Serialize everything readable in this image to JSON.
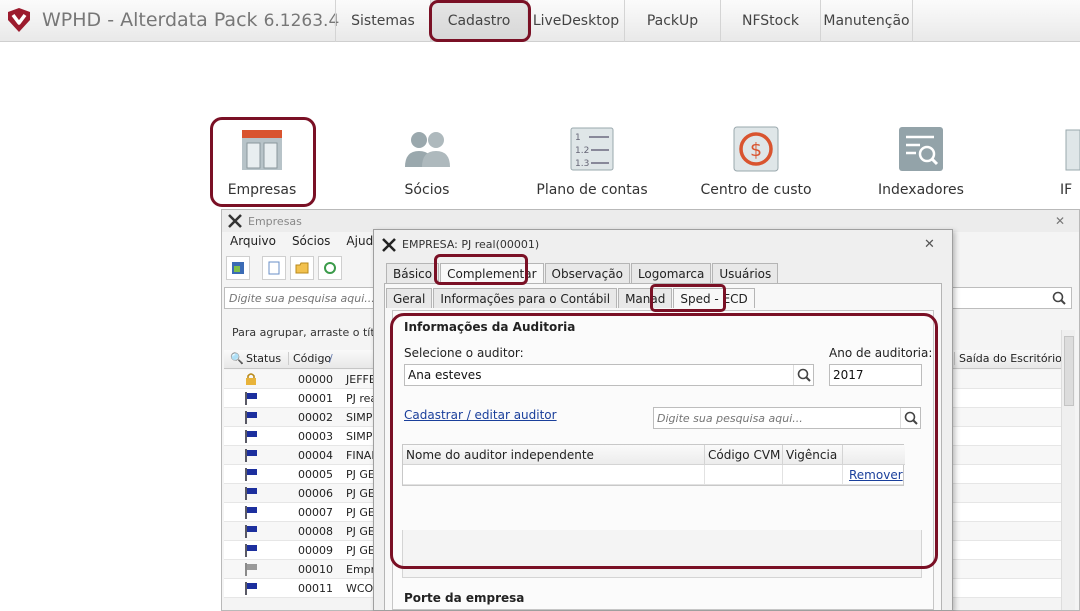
{
  "app": {
    "brand": "WPHD - Alterdata Pack",
    "version": "6.1263.4",
    "menu": [
      "Sistemas",
      "Cadastro",
      "LiveDesktop",
      "PackUp",
      "NFStock",
      "Manutenção"
    ],
    "active_menu": "Cadastro",
    "accent_color": "#7a1025"
  },
  "ribbon": [
    {
      "label": "Empresas",
      "icon": "store-icon"
    },
    {
      "label": "Sócios",
      "icon": "partners-icon"
    },
    {
      "label": "Plano de contas",
      "icon": "numbered-list-icon"
    },
    {
      "label": "Centro de custo",
      "icon": "dollar-icon"
    },
    {
      "label": "Indexadores",
      "icon": "document-search-icon"
    },
    {
      "label": "IF",
      "icon": "partial-icon"
    }
  ],
  "empresas_window": {
    "title": "Empresas",
    "menu": [
      "Arquivo",
      "Sócios",
      "Ajuda"
    ],
    "search_placeholder": "Digite sua pesquisa aqui...",
    "group_hint": "Para agrupar, arraste o título d",
    "columns": [
      "Status",
      "Código",
      "Saída do Escritório"
    ],
    "rows": [
      {
        "status": "lock",
        "codigo": "00000",
        "nome": "JEFFE"
      },
      {
        "status": "flag",
        "codigo": "00001",
        "nome": "PJ rea"
      },
      {
        "status": "flag",
        "codigo": "00002",
        "nome": "SIMP"
      },
      {
        "status": "flag",
        "codigo": "00003",
        "nome": "SIMP"
      },
      {
        "status": "flag",
        "codigo": "00004",
        "nome": "FINAN"
      },
      {
        "status": "flag",
        "codigo": "00005",
        "nome": "PJ GE"
      },
      {
        "status": "flag",
        "codigo": "00006",
        "nome": "PJ GE"
      },
      {
        "status": "flag",
        "codigo": "00007",
        "nome": "PJ GE"
      },
      {
        "status": "flag",
        "codigo": "00008",
        "nome": "PJ GE"
      },
      {
        "status": "flag",
        "codigo": "00009",
        "nome": "PJ GE"
      },
      {
        "status": "flag-gray",
        "codigo": "00010",
        "nome": "Empre"
      },
      {
        "status": "flag",
        "codigo": "00011",
        "nome": "WCO"
      }
    ]
  },
  "dialog": {
    "title": "EMPRESA: PJ real(00001)",
    "tabs": [
      "Básico",
      "Complementar",
      "Observação",
      "Logomarca",
      "Usuários"
    ],
    "active_tab": "Complementar",
    "subtabs": [
      "Geral",
      "Informações para o Contábil",
      "Manad",
      "Sped - ECD"
    ],
    "active_subtab": "Sped - ECD",
    "section_title": "Informações da Auditoria",
    "auditor_label": "Selecione o auditor:",
    "auditor_value": "Ana esteves",
    "ano_label": "Ano de auditoria:",
    "ano_value": "2017",
    "link_cadastrar": "Cadastrar / editar auditor",
    "search_placeholder": "Digite sua pesquisa aqui...",
    "grid_columns": [
      "Nome do auditor independente",
      "Código CVM",
      "Vigência"
    ],
    "remover_label": "Remover",
    "porte_title": "Porte da empresa"
  }
}
